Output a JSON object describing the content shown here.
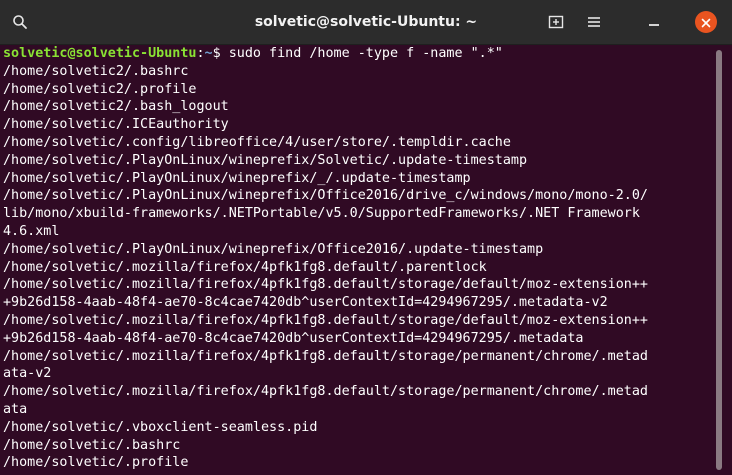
{
  "window": {
    "title": "solvetic@solvetic-Ubuntu: ~"
  },
  "prompt": {
    "user_host": "solvetic@solvetic-Ubuntu",
    "separator": ":",
    "path": "~",
    "symbol": "$",
    "command": " sudo find /home -type f -name \".*\""
  },
  "output": [
    "/home/solvetic2/.bashrc",
    "/home/solvetic2/.profile",
    "/home/solvetic2/.bash_logout",
    "/home/solvetic/.ICEauthority",
    "/home/solvetic/.config/libreoffice/4/user/store/.templdir.cache",
    "/home/solvetic/.PlayOnLinux/wineprefix/Solvetic/.update-timestamp",
    "/home/solvetic/.PlayOnLinux/wineprefix/_/.update-timestamp",
    "/home/solvetic/.PlayOnLinux/wineprefix/Office2016/drive_c/windows/mono/mono-2.0/",
    "lib/mono/xbuild-frameworks/.NETPortable/v5.0/SupportedFrameworks/.NET Framework",
    "4.6.xml",
    "/home/solvetic/.PlayOnLinux/wineprefix/Office2016/.update-timestamp",
    "/home/solvetic/.mozilla/firefox/4pfk1fg8.default/.parentlock",
    "/home/solvetic/.mozilla/firefox/4pfk1fg8.default/storage/default/moz-extension++",
    "+9b26d158-4aab-48f4-ae70-8c4cae7420db^userContextId=4294967295/.metadata-v2",
    "/home/solvetic/.mozilla/firefox/4pfk1fg8.default/storage/default/moz-extension++",
    "+9b26d158-4aab-48f4-ae70-8c4cae7420db^userContextId=4294967295/.metadata",
    "/home/solvetic/.mozilla/firefox/4pfk1fg8.default/storage/permanent/chrome/.metad",
    "ata-v2",
    "/home/solvetic/.mozilla/firefox/4pfk1fg8.default/storage/permanent/chrome/.metad",
    "ata",
    "/home/solvetic/.vboxclient-seamless.pid",
    "/home/solvetic/.bashrc",
    "/home/solvetic/.profile"
  ],
  "icons": {
    "search": "search-icon",
    "new_tab": "new-tab-icon",
    "menu": "hamburger-menu-icon",
    "minimize": "minimize-icon",
    "close": "close-icon"
  },
  "colors": {
    "background": "#300a24",
    "titlebar": "#2c2c2c",
    "prompt_user": "#8ae234",
    "prompt_path": "#729fcf",
    "close_button": "#e95420"
  }
}
